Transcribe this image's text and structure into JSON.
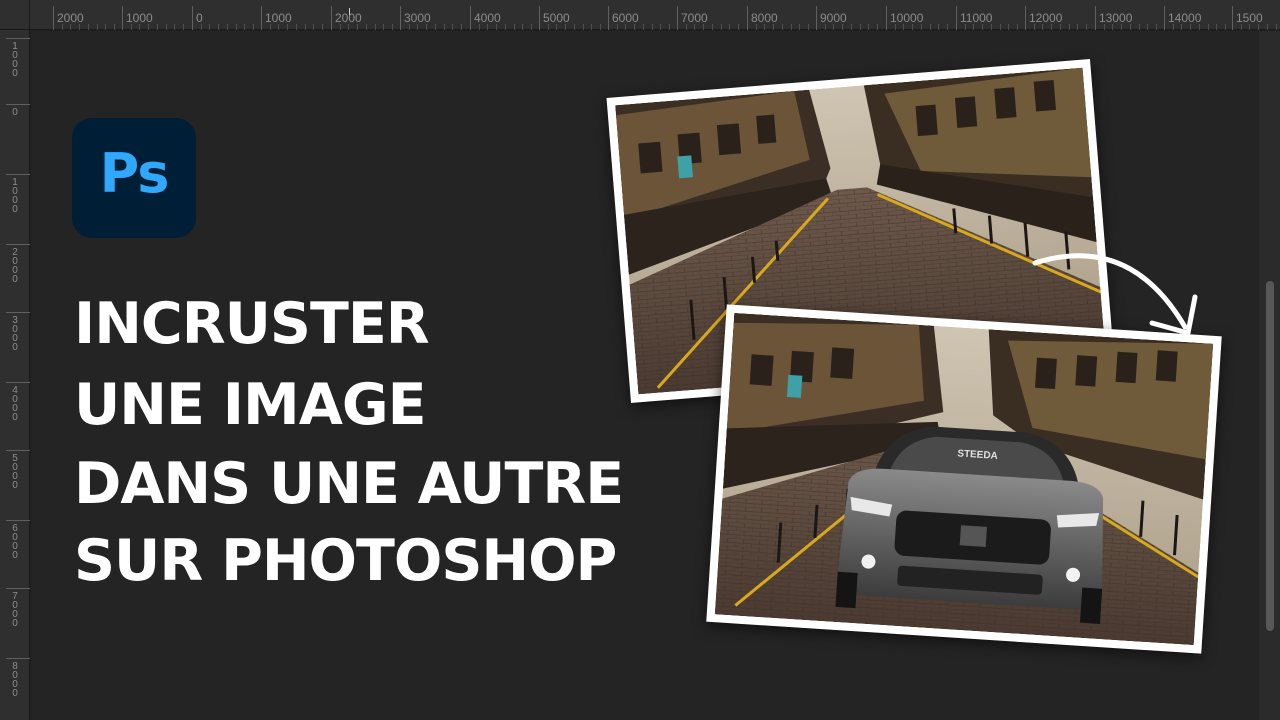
{
  "ruler": {
    "top_labels": [
      "2000",
      "1000",
      "0",
      "1000",
      "2000",
      "3000",
      "4000",
      "5000",
      "6000",
      "7000",
      "8000",
      "9000",
      "10000",
      "11000",
      "12000",
      "13000",
      "14000",
      "1500"
    ],
    "left_labels": [
      "1000",
      "0",
      "1000",
      "2000",
      "3000",
      "4000",
      "5000",
      "6000",
      "7000",
      "8000"
    ]
  },
  "logo": {
    "text": "Ps",
    "bg_color": "#001e36",
    "text_color": "#31a8ff"
  },
  "headline": {
    "line1": "INCRUSTER",
    "line2": "UNE IMAGE",
    "line3": "DANS UNE AUTRE",
    "line4": "SUR PHOTOSHOP"
  },
  "photos": {
    "top": {
      "subject": "street-scene"
    },
    "bottom": {
      "subject": "street-scene-with-car",
      "plate_text": "STEEDA"
    }
  },
  "icons": {
    "arrow": "curved-arrow-icon"
  },
  "colors": {
    "background": "#242424",
    "ruler": "#2f2f2f",
    "text": "#ffffff"
  }
}
